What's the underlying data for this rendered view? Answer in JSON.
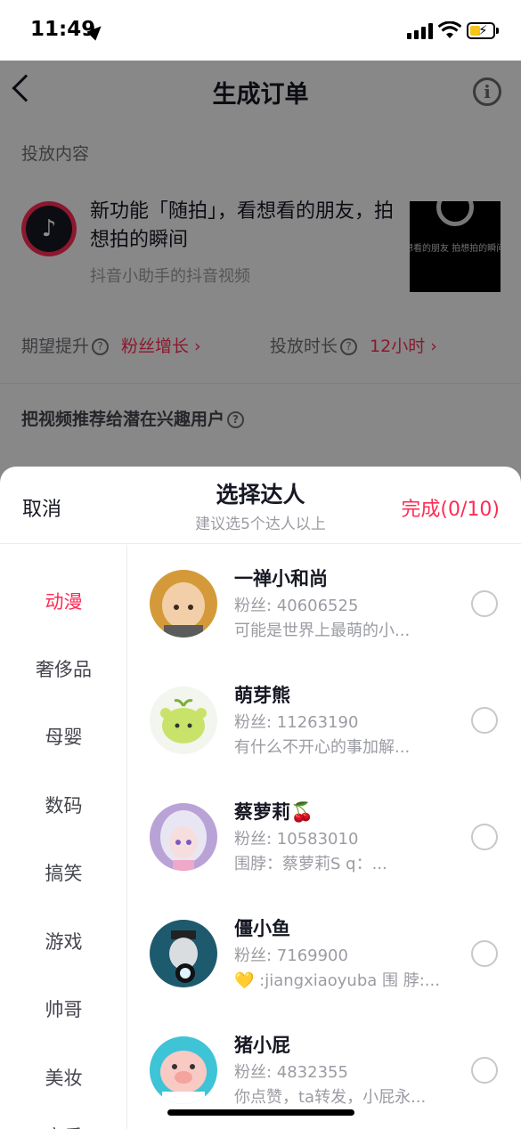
{
  "status_bar": {
    "time": "11:49"
  },
  "page": {
    "title": "生成订单",
    "section_content": "投放内容",
    "video": {
      "title": "新功能「随拍」，看想看的朋友，拍想拍的瞬间",
      "subtitle": "抖音小助手的抖音视频",
      "thumb_caption": "想看的朋友  拍想拍的瞬间"
    },
    "expect_label": "期望提升",
    "expect_value": "粉丝增长 ›",
    "duration_label": "投放时长",
    "duration_value": "12小时 ›",
    "recommend_label": "把视频推荐给潜在兴趣用户"
  },
  "sheet": {
    "cancel": "取消",
    "title": "选择达人",
    "subtitle": "建议选5个达人以上",
    "done": "完成(0/10)",
    "categories": [
      "动漫",
      "奢侈品",
      "母婴",
      "数码",
      "搞笑",
      "游戏",
      "帅哥",
      "美妆",
      "音乐"
    ],
    "users": [
      {
        "name": "一禅小和尚",
        "fans": "粉丝: 40606525",
        "desc": "可能是世界上最萌的小..."
      },
      {
        "name": "萌芽熊",
        "fans": "粉丝: 11263190",
        "desc": "有什么不开心的事加解..."
      },
      {
        "name": "蔡萝莉🍒",
        "fans": "粉丝: 10583010",
        "desc": "围脖：蔡萝莉S q：..."
      },
      {
        "name": "僵小鱼",
        "fans": "粉丝: 7169900",
        "desc": "💛 :jiangxiaoyuba 围 脖:..."
      },
      {
        "name": "猪小屁",
        "fans": "粉丝: 4832355",
        "desc": "你点赞，ta转发，小屁永..."
      }
    ]
  },
  "colors": {
    "accent": "#fe2c55",
    "text": "#161823",
    "muted": "#9b9ca3"
  }
}
